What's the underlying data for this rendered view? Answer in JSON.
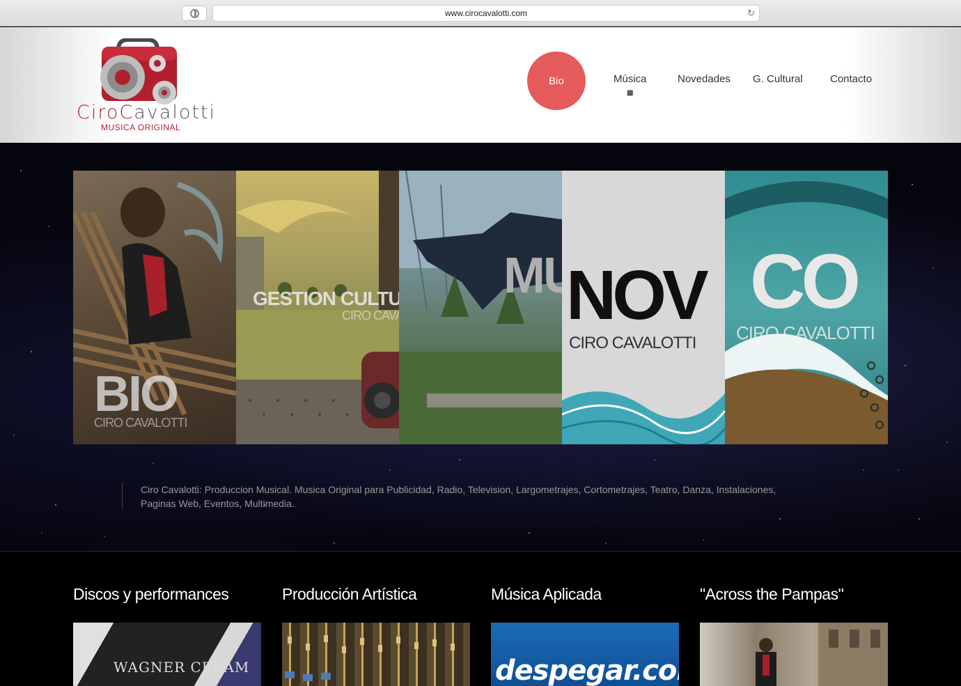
{
  "browser": {
    "url": "www.cirocavalotti.com"
  },
  "logo": {
    "name_part1": "Ciro",
    "name_part2": "C",
    "name_part3": "avalotti",
    "subtitle": "MUSICA ORIGINAL"
  },
  "nav": {
    "items": [
      {
        "label": "Bio",
        "active": true
      },
      {
        "label": "Música",
        "active": false
      },
      {
        "label": "Novedades",
        "active": false
      },
      {
        "label": "G. Cultural",
        "active": false
      },
      {
        "label": "Contacto",
        "active": false
      }
    ]
  },
  "colors": {
    "accent": "#e55a5a",
    "brand_red": "#b21f2d"
  },
  "slider": {
    "panels": [
      {
        "title": "BIO",
        "subtitle": "CIRO CAVALOTTI"
      },
      {
        "title": "GESTION CULTU",
        "subtitle": "CIRO CAVA"
      },
      {
        "title": "MU",
        "subtitle": ""
      },
      {
        "title": "NOV",
        "subtitle": "CIRO CAVALOTTI"
      },
      {
        "title": "CO",
        "subtitle": "CIRO CAVALOTTI"
      }
    ]
  },
  "description": "Ciro Cavalotti: Produccion Musical. Musica Original para Publicidad, Radio, Television, Largometrajes, Cortometrajes, Teatro, Danza, Instalaciones, Paginas Web, Eventos, Multimedia.",
  "sections": [
    {
      "title": "Discos y performances",
      "image_text": "WAGNER CREAM"
    },
    {
      "title": "Producción Artística",
      "image_text": ""
    },
    {
      "title": "Música Aplicada",
      "image_text": "despegar.com"
    },
    {
      "title": "\"Across the Pampas\"",
      "image_text": ""
    }
  ]
}
